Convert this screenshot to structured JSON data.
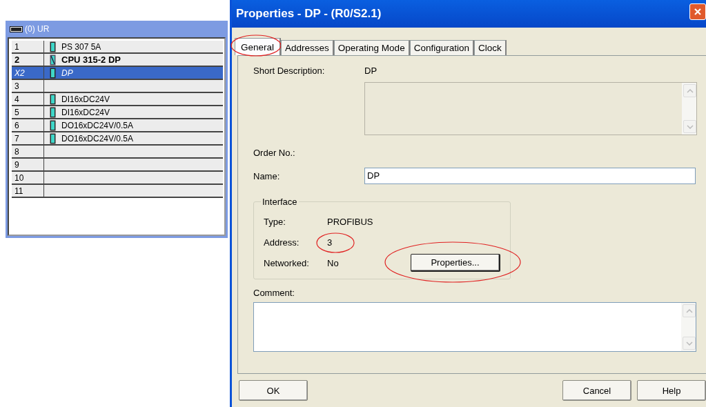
{
  "rack": {
    "title": "(0) UR",
    "rows": [
      {
        "slot": "1",
        "kind": "module",
        "module": "PS 307 5A",
        "selected": false
      },
      {
        "slot": "2",
        "kind": "cpu",
        "module": "CPU 315-2 DP",
        "selected": false
      },
      {
        "slot": "X2",
        "kind": "submodule",
        "module": "DP",
        "selected": true
      },
      {
        "slot": "3",
        "kind": "empty",
        "selected": false
      },
      {
        "slot": "4",
        "kind": "module",
        "module": "DI16xDC24V",
        "selected": false
      },
      {
        "slot": "5",
        "kind": "module",
        "module": "DI16xDC24V",
        "selected": false
      },
      {
        "slot": "6",
        "kind": "module",
        "module": "DO16xDC24V/0.5A",
        "selected": false
      },
      {
        "slot": "7",
        "kind": "module",
        "module": "DO16xDC24V/0.5A",
        "selected": false
      },
      {
        "slot": "8",
        "kind": "empty",
        "selected": false
      },
      {
        "slot": "9",
        "kind": "empty",
        "selected": false
      },
      {
        "slot": "10",
        "kind": "empty",
        "selected": false
      },
      {
        "slot": "11",
        "kind": "empty",
        "selected": false
      }
    ]
  },
  "dialog": {
    "title": "Properties - DP - (R0/S2.1)",
    "tabs": [
      {
        "label": "General",
        "selected": true,
        "circled": true
      },
      {
        "label": "Addresses",
        "selected": false,
        "circled": false
      },
      {
        "label": "Operating Mode",
        "selected": false,
        "circled": false
      },
      {
        "label": "Configuration",
        "selected": false,
        "circled": false
      },
      {
        "label": "Clock",
        "selected": false,
        "circled": false
      }
    ],
    "short_description": {
      "label": "Short Description:",
      "value": "DP"
    },
    "order_no": {
      "label": "Order No.:"
    },
    "name": {
      "label": "Name:",
      "value": "DP"
    },
    "interface": {
      "title": "Interface",
      "fields": [
        {
          "label": "Type:",
          "value": "PROFIBUS",
          "circled": false
        },
        {
          "label": "Address:",
          "value": "3",
          "circled": true
        },
        {
          "label": "Networked:",
          "value": "No",
          "circled": false
        }
      ],
      "button": {
        "label": "Properties...",
        "circled": true
      }
    },
    "comment": {
      "label": "Comment:"
    },
    "buttons_left": [
      "OK"
    ],
    "buttons_right": [
      "Cancel",
      "Help"
    ]
  }
}
